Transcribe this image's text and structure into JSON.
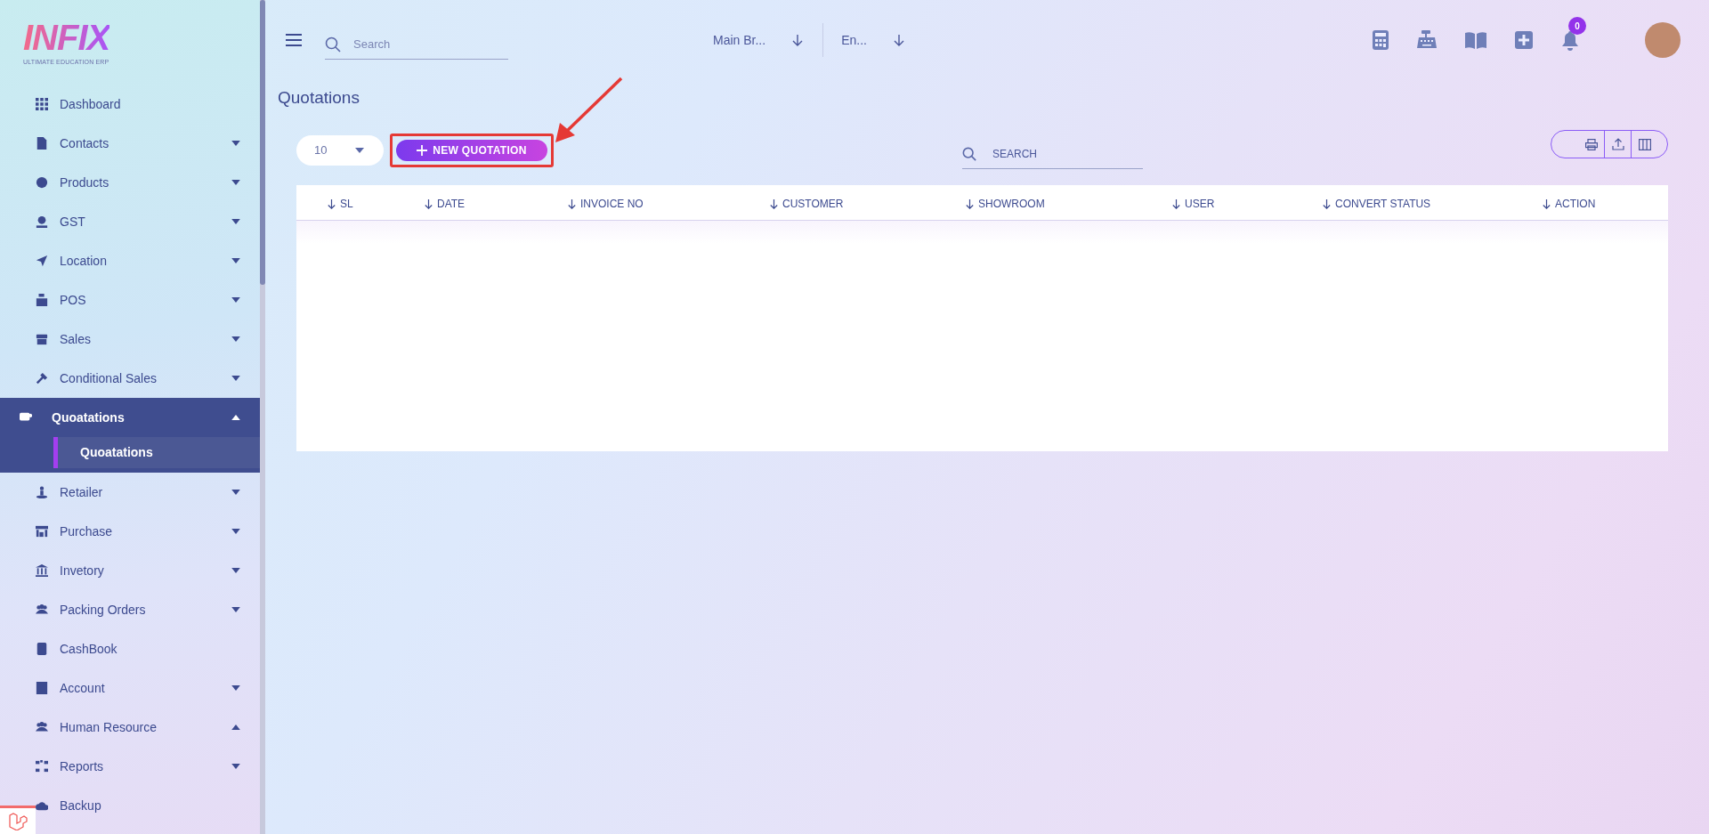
{
  "logo": {
    "title": "INFIX",
    "subtitle": "ULTIMATE EDUCATION ERP"
  },
  "sidebar": {
    "items": [
      {
        "label": "Dashboard",
        "kind": "link",
        "selected": false
      },
      {
        "label": "Contacts",
        "kind": "dropdown",
        "expanded": false,
        "selected": false
      },
      {
        "label": "Products",
        "kind": "dropdown",
        "expanded": false,
        "selected": false
      },
      {
        "label": "GST",
        "kind": "dropdown",
        "expanded": false,
        "selected": false
      },
      {
        "label": "Location",
        "kind": "dropdown",
        "expanded": false,
        "selected": false
      },
      {
        "label": "POS",
        "kind": "dropdown",
        "expanded": false,
        "selected": false
      },
      {
        "label": "Sales",
        "kind": "dropdown",
        "expanded": false,
        "selected": false
      },
      {
        "label": "Conditional Sales",
        "kind": "dropdown",
        "expanded": false,
        "selected": false
      },
      {
        "label": "Quoatations",
        "kind": "dropdown",
        "expanded": true,
        "selected": true,
        "children": [
          {
            "label": "Quoatations",
            "selected": true
          }
        ]
      },
      {
        "label": "Retailer",
        "kind": "dropdown",
        "expanded": false,
        "selected": false
      },
      {
        "label": "Purchase",
        "kind": "dropdown",
        "expanded": false,
        "selected": false
      },
      {
        "label": "Invetory",
        "kind": "dropdown",
        "expanded": false,
        "selected": false
      },
      {
        "label": "Packing Orders",
        "kind": "dropdown",
        "expanded": false,
        "selected": false
      },
      {
        "label": "CashBook",
        "kind": "link",
        "selected": false
      },
      {
        "label": "Account",
        "kind": "dropdown",
        "expanded": false,
        "selected": false
      },
      {
        "label": "Human Resource",
        "kind": "dropdown",
        "expanded": true,
        "selected": false
      },
      {
        "label": "Reports",
        "kind": "dropdown",
        "expanded": false,
        "selected": false
      },
      {
        "label": "Backup",
        "kind": "link",
        "selected": false
      }
    ]
  },
  "header": {
    "search": {
      "placeholder": "Search"
    },
    "branch": "Main Br...",
    "language": "En...",
    "notification_count": "0"
  },
  "page": {
    "title": "Quotations",
    "page_size": "10",
    "new_button": "NEW QUOTATION",
    "search": {
      "placeholder": "SEARCH"
    },
    "table": {
      "columns": [
        "SL",
        "DATE",
        "INVOICE NO",
        "CUSTOMER",
        "SHOWROOM",
        "USER",
        "CONVERT STATUS",
        "ACTION"
      ]
    }
  }
}
